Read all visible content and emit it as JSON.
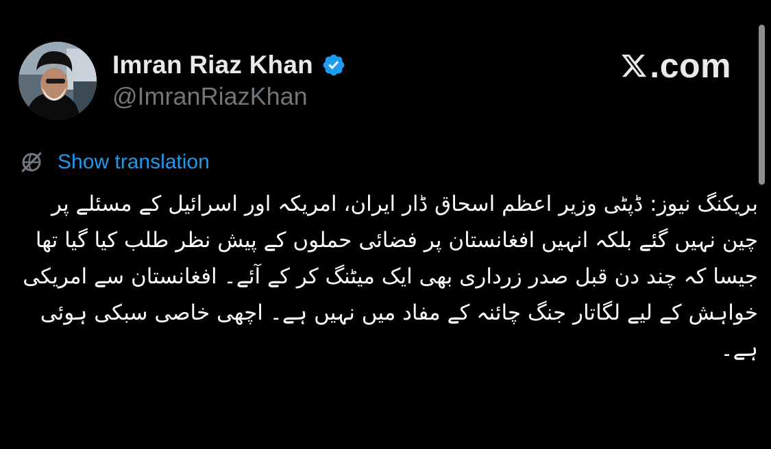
{
  "author": {
    "display_name": "Imran Riaz Khan",
    "handle": "@ImranRiazKhan",
    "verified_color": "#1d9bf0"
  },
  "brand": {
    "text": ".com",
    "logo_icon": "x-logo-icon"
  },
  "translation": {
    "label": "Show translation",
    "icon": "globe-off-icon",
    "color": "#1d9bf0"
  },
  "tweet": {
    "text": "بریکنگ نیوز: ڈپٹی وزیر اعظم اسحاق ڈار ایران، امریکہ اور اسرائیل کے مسئلے پر چین نہیں گئے بلکہ انہیں افغانستان پر فضائی حملوں کے پیش نظر طلب کیا گیا تھا جیسا کہ چند دن قبل صدر زرداری بھی ایک میٹنگ کر کے آئے۔ افغانستان سے امریکی خواہش کے لیے لگاتار جنگ چائنہ کے مفاد میں نہیں ہے۔ اچھی خاصی سبکی ہوئی ہے۔"
  },
  "theme": {
    "background": "#000000",
    "text_primary": "#e7e9ea",
    "text_secondary": "#71767b"
  }
}
